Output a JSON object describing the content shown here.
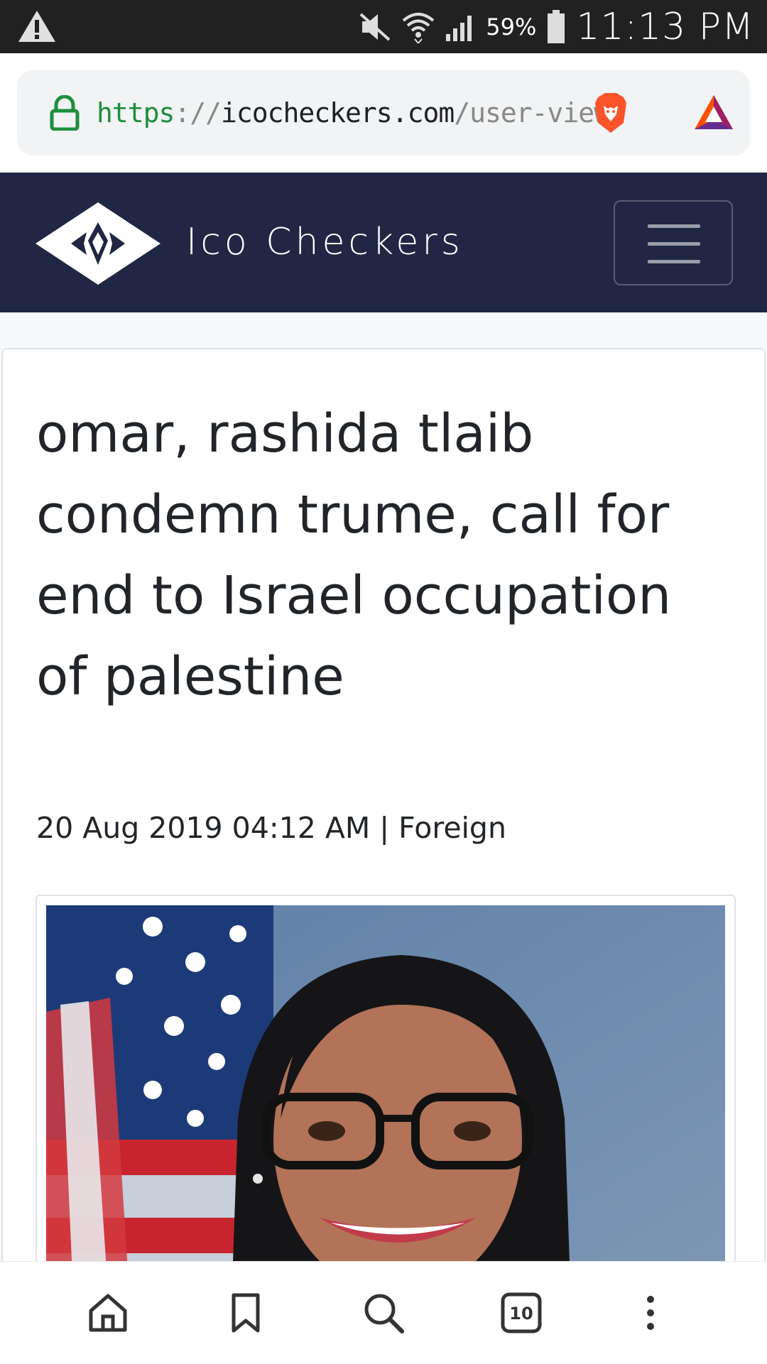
{
  "status_bar": {
    "battery_percent": "59%",
    "time": "11:13 PM",
    "icons": [
      "warning-icon",
      "mute-icon",
      "wifi-icon",
      "signal-icon",
      "battery-icon"
    ]
  },
  "browser": {
    "url_scheme": "https",
    "url_separator": "://",
    "url_host": "icocheckers.com",
    "url_path": "/user-view/",
    "tab_count": "10",
    "icons": [
      "lock-icon",
      "brave-shield-icon",
      "bat-rewards-icon"
    ]
  },
  "site": {
    "brand_name": "Ico Checkers",
    "colors": {
      "navbar": "#1f2744",
      "text": "#212529"
    }
  },
  "article": {
    "title": "omar, rashida tlaib condemn trume, call for end to Israel occupation of palestine",
    "meta": "20 Aug 2019 04:12 AM | Foreign"
  },
  "bottom_nav": {
    "icons": [
      "home-icon",
      "bookmark-icon",
      "search-icon",
      "tabs-icon",
      "more-icon"
    ]
  }
}
